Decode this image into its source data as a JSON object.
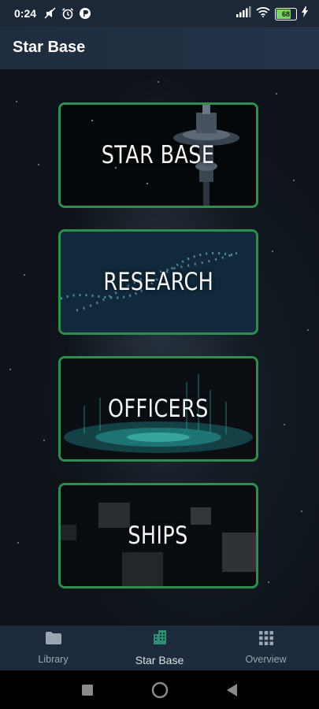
{
  "status_bar": {
    "time": "0:24",
    "battery": "68"
  },
  "app_bar": {
    "title": "Star Base"
  },
  "cards": [
    {
      "label": "STAR BASE"
    },
    {
      "label": "RESEARCH"
    },
    {
      "label": "OFFICERS"
    },
    {
      "label": "SHIPS"
    }
  ],
  "bottom_nav": {
    "items": [
      {
        "label": "Library",
        "icon": "folder-icon"
      },
      {
        "label": "Star Base",
        "icon": "building-icon",
        "active": true
      },
      {
        "label": "Overview",
        "icon": "grid-icon"
      }
    ]
  },
  "colors": {
    "card_border": "#2f8e4d",
    "active_icon": "#2f8e73",
    "app_bar": "#1f2c3d"
  }
}
